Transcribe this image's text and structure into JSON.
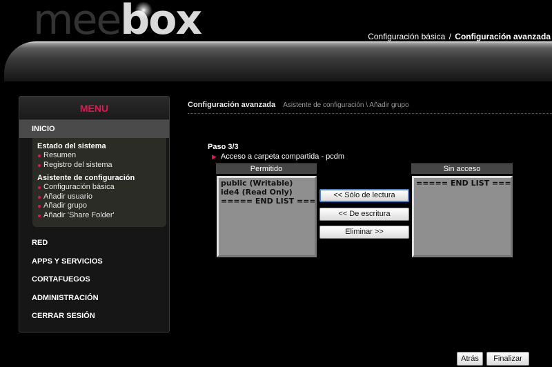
{
  "logo": {
    "part1": "mee",
    "part2": "box"
  },
  "header_nav": {
    "basic": "Configuración básica",
    "separator": "/",
    "advanced": "Configuración avanzada"
  },
  "sidebar": {
    "title": "MENU",
    "inicio": "INICIO",
    "sections": [
      {
        "heading": "Estado del sistema",
        "items": [
          "Resumen",
          "Registro del sistema"
        ]
      },
      {
        "heading": "Asistente de configuración",
        "items": [
          "Configuración básica",
          "Añadir usuario",
          "Añadir grupo",
          "Añadir 'Share Folder'"
        ]
      }
    ],
    "menu": [
      "RED",
      "APPS Y SERVICIOS",
      "CORTAFUEGOS",
      "ADMINISTRACIÓN",
      "CERRAR SESIÓN"
    ]
  },
  "breadcrumb": {
    "current": "Configuración avanzada",
    "path": "Asistente de configuración \\ Añadir grupo"
  },
  "step": "Paso 3/3",
  "share_label": "Acceso a carpeta compartida - pcdm",
  "permitted": {
    "header": "Permitido",
    "items": [
      "public (Writable)",
      "ide4 (Read Only)",
      "===== END LIST ====="
    ]
  },
  "no_access": {
    "header": "Sin acceso",
    "items": [
      "===== END LIST ====="
    ]
  },
  "buttons": {
    "read_only": "<< Sólo de lectura",
    "write": "<< De escritura",
    "remove": "Eliminar >>",
    "back": "Atrás",
    "finish": "Finalizar"
  },
  "colors": {
    "accent": "#e5154f",
    "background": "#000000",
    "list_bg": "#8f8f8f",
    "selected_border": "#4a7fd4"
  }
}
